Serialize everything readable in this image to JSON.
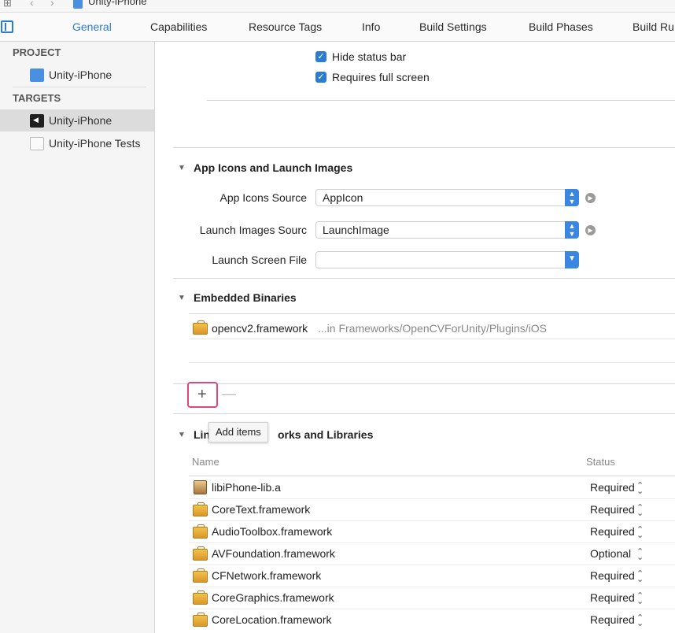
{
  "window": {
    "breadcrumb": "Unity-iPhone"
  },
  "tabs": [
    {
      "label": "General"
    },
    {
      "label": "Capabilities"
    },
    {
      "label": "Resource Tags"
    },
    {
      "label": "Info"
    },
    {
      "label": "Build Settings"
    },
    {
      "label": "Build Phases"
    },
    {
      "label": "Build Ru"
    }
  ],
  "sidebar": {
    "project_header": "PROJECT",
    "project_item": "Unity-iPhone",
    "targets_header": "TARGETS",
    "targets": [
      {
        "label": "Unity-iPhone"
      },
      {
        "label": "Unity-iPhone Tests"
      }
    ]
  },
  "deployment": {
    "hide_status_bar": "Hide status bar",
    "requires_full_screen": "Requires full screen"
  },
  "app_icons": {
    "title": "App Icons and Launch Images",
    "icons_source_label": "App Icons Source",
    "icons_source_value": "AppIcon",
    "launch_images_label": "Launch Images Sourc",
    "launch_images_value": "LaunchImage",
    "launch_screen_label": "Launch Screen File",
    "launch_screen_value": ""
  },
  "embedded": {
    "title": "Embedded Binaries",
    "items": [
      {
        "name": "opencv2.framework",
        "path": "...in Frameworks/OpenCVForUnity/Plugins/iOS"
      }
    ],
    "add_symbol": "+",
    "remove_symbol": "—",
    "tooltip": "Add items"
  },
  "linked": {
    "title_left": "Lin",
    "title_right": "orks and Libraries",
    "col_name": "Name",
    "col_status": "Status",
    "rows": [
      {
        "name": "libiPhone-lib.a",
        "status": "Required"
      },
      {
        "name": "CoreText.framework",
        "status": "Required"
      },
      {
        "name": "AudioToolbox.framework",
        "status": "Required"
      },
      {
        "name": "AVFoundation.framework",
        "status": "Optional"
      },
      {
        "name": "CFNetwork.framework",
        "status": "Required"
      },
      {
        "name": "CoreGraphics.framework",
        "status": "Required"
      },
      {
        "name": "CoreLocation.framework",
        "status": "Required"
      }
    ]
  }
}
